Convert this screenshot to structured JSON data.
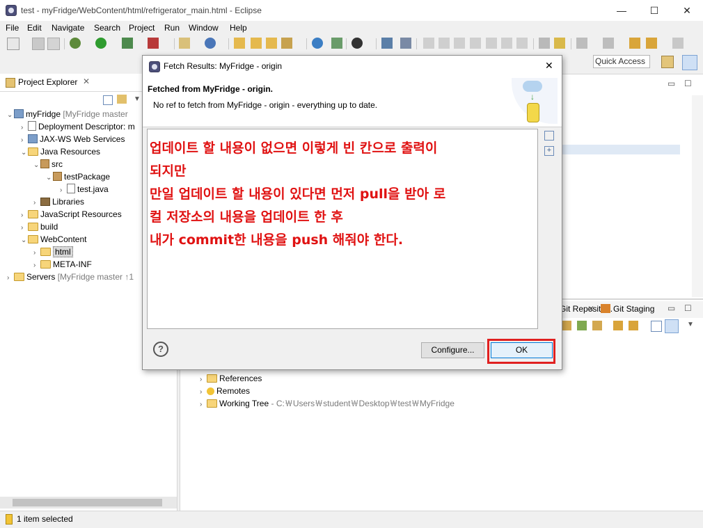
{
  "window": {
    "title": "test - myFridge/WebContent/html/refrigerator_main.html - Eclipse",
    "minimize": "—",
    "maximize": "☐",
    "close": "✕"
  },
  "menu": [
    "File",
    "Edit",
    "Navigate",
    "Search",
    "Project",
    "Run",
    "Window",
    "Help"
  ],
  "quick_access": {
    "placeholder": "Quick Access"
  },
  "project_explorer": {
    "tab_label": "Project Explorer",
    "tree": [
      {
        "label": "myFridge",
        "decoration": "[MyFridge master",
        "expanded": true
      },
      {
        "label": "Deployment Descriptor: m"
      },
      {
        "label": "JAX-WS Web Services"
      },
      {
        "label": "Java Resources",
        "expanded": true
      },
      {
        "label": "src",
        "expanded": true
      },
      {
        "label": "testPackage",
        "expanded": true
      },
      {
        "label": "test.java"
      },
      {
        "label": "Libraries"
      },
      {
        "label": "JavaScript Resources"
      },
      {
        "label": "build"
      },
      {
        "label": "WebContent",
        "expanded": true
      },
      {
        "label": "html",
        "selected": true
      },
      {
        "label": "META-INF"
      },
      {
        "label": "Servers",
        "decoration": "[MyFridge master ↑1"
      }
    ]
  },
  "git_panel": {
    "tab_repos": "Git Reposito...",
    "tab_staging": "Git Staging",
    "tree": [
      {
        "label": "References"
      },
      {
        "label": "Remotes"
      },
      {
        "label": "Working Tree",
        "path": "- C:￦Users￦student￦Desktop￦test￦MyFridge"
      }
    ]
  },
  "status_bar": {
    "text": "1 item selected"
  },
  "dialog": {
    "title": "Fetch Results: MyFridge - origin",
    "close": "✕",
    "heading": "Fetched from MyFridge - origin.",
    "message": "No ref to fetch from MyFridge - origin - everything up to date.",
    "content_lines": [
      "업데이트 할 내용이 없으면 이렇게 빈 칸으로 출력이",
      "되지만",
      "만일 업데이트 할 내용이 있다면 먼저 pull을 받아 로",
      "컬 저장소의 내용을 업데이트 한 후",
      "내가 commit한 내용을 push 해줘야 한다."
    ],
    "configure_button": "Configure...",
    "ok_button": "OK",
    "help": "?",
    "highlight_color": "#e02020",
    "annotation_color": "#e01212"
  }
}
